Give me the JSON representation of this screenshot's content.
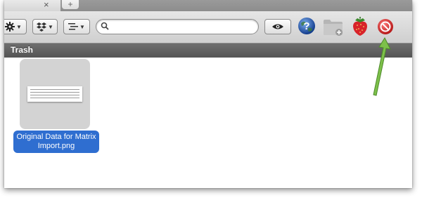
{
  "tabs": {
    "close_glyph": "×",
    "new_tab_glyph": "+"
  },
  "toolbar": {
    "action_icon": "gear-icon",
    "dropbox_icon": "dropbox-icon",
    "arrange_icon": "list-arrange-icon",
    "search": {
      "value": "",
      "placeholder": ""
    },
    "quicklook_icon": "eye-icon",
    "help_icon": "help-globe-icon",
    "new_folder_icon": "new-folder-icon",
    "app_icon": "strawberry-icon",
    "forbidden_icon": "no-entry-icon"
  },
  "pathbar": {
    "title": "Trash"
  },
  "files": [
    {
      "name": "Original Data for Matrix Import.png",
      "selected": true
    }
  ],
  "colors": {
    "selection": "#2f6ed0",
    "arrow": "#7dc04a",
    "pathbar": "#5e5e5e"
  }
}
